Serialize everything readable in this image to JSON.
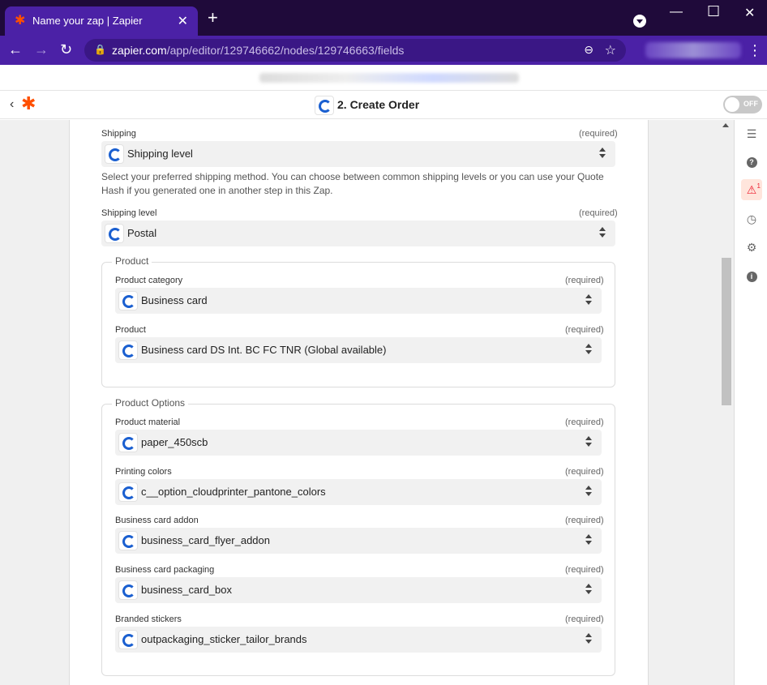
{
  "browser": {
    "tab_title": "Name your zap | Zapier",
    "url_host": "zapier.com",
    "url_path": "/app/editor/129746662/nodes/129746663/fields"
  },
  "header": {
    "step_title": "2. Create Order",
    "toggle_label": "OFF"
  },
  "fields": {
    "shipping": {
      "label": "Shipping",
      "required": "(required)",
      "value": "Shipping level",
      "help": "Select your preferred shipping method. You can choose between common shipping levels or you can use your Quote Hash if you generated one in another step in this Zap."
    },
    "shipping_level": {
      "label": "Shipping level",
      "required": "(required)",
      "value": "Postal"
    }
  },
  "product_group": {
    "legend": "Product",
    "fields": [
      {
        "label": "Product category",
        "required": "(required)",
        "value": "Business card"
      },
      {
        "label": "Product",
        "required": "(required)",
        "value": "Business card DS Int. BC FC TNR (Global available)"
      }
    ]
  },
  "options_group": {
    "legend": "Product Options",
    "fields": [
      {
        "label": "Product material",
        "required": "(required)",
        "value": "paper_450scb"
      },
      {
        "label": "Printing colors",
        "required": "(required)",
        "value": "c__option_cloudprinter_pantone_colors"
      },
      {
        "label": "Business card addon",
        "required": "(required)",
        "value": "business_card_flyer_addon"
      },
      {
        "label": "Business card packaging",
        "required": "(required)",
        "value": "business_card_box"
      },
      {
        "label": "Branded stickers",
        "required": "(required)",
        "value": "outpackaging_sticker_tailor_brands"
      }
    ]
  },
  "sidebar": {
    "alert_count": "1",
    "icons": [
      "details-icon",
      "help-icon",
      "alert-icon",
      "history-icon",
      "settings-icon",
      "info-icon"
    ]
  },
  "colors": {
    "brand": "#ff4f00",
    "browser": "#4b21a6",
    "app_icon": "#1a5fd0"
  }
}
